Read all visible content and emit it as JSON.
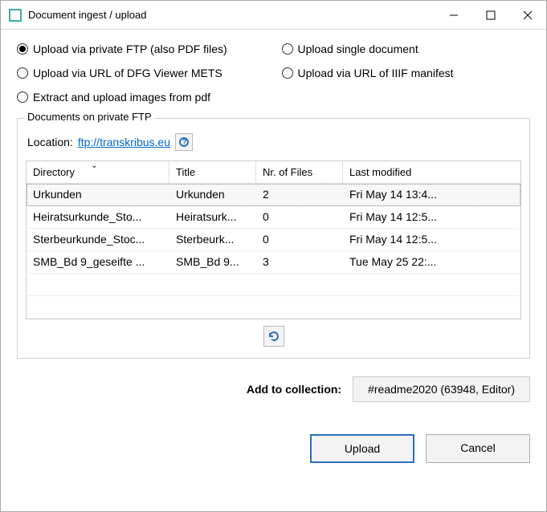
{
  "window": {
    "title": "Document ingest / upload"
  },
  "radios": {
    "ftp": "Upload via private FTP (also PDF files)",
    "single": "Upload single document",
    "dfg": "Upload via URL of DFG Viewer METS",
    "iiif": "Upload via URL of IIIF manifest",
    "pdf": "Extract and upload images from pdf"
  },
  "group": {
    "title": "Documents on private FTP",
    "location_label": "Location:",
    "location_url": "ftp://transkribus.eu"
  },
  "table": {
    "headers": {
      "directory": "Directory",
      "title": "Title",
      "files": "Nr. of Files",
      "modified": "Last modified"
    },
    "rows": [
      {
        "directory": "Urkunden",
        "title": "Urkunden",
        "files": "2",
        "modified": "Fri May 14 13:4..."
      },
      {
        "directory": "Heiratsurkunde_Sto...",
        "title": "Heiratsurk...",
        "files": "0",
        "modified": "Fri May 14 12:5..."
      },
      {
        "directory": "Sterbeurkunde_Stoc...",
        "title": "Sterbeurk...",
        "files": "0",
        "modified": "Fri May 14 12:5..."
      },
      {
        "directory": "SMB_Bd 9_geseifte ...",
        "title": "SMB_Bd 9...",
        "files": "3",
        "modified": "Tue May 25 22:..."
      }
    ]
  },
  "collection": {
    "label": "Add to collection:",
    "value": "#readme2020 (63948, Editor)"
  },
  "buttons": {
    "upload": "Upload",
    "cancel": "Cancel"
  }
}
